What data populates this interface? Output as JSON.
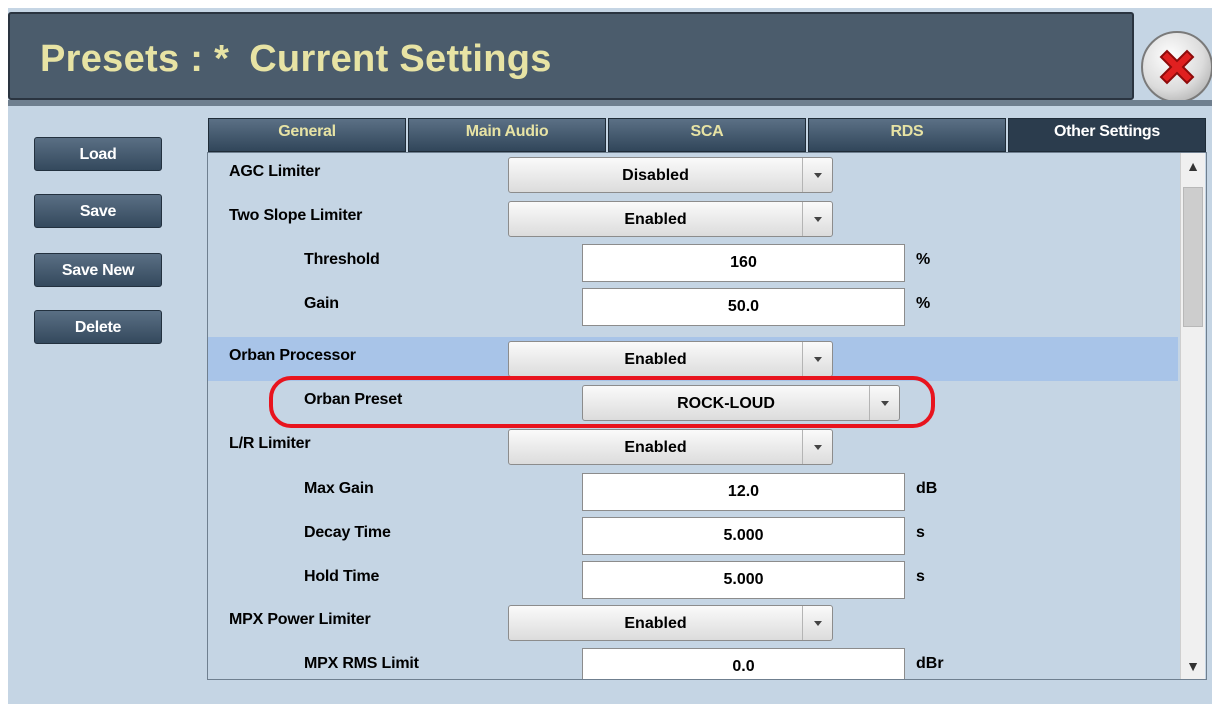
{
  "header": {
    "title_prefix": "Presets : *",
    "title_main": "Current Settings"
  },
  "sidebar": {
    "buttons": [
      "Load",
      "Save",
      "Save New",
      "Delete"
    ]
  },
  "tabs": [
    {
      "label": "General",
      "active": false
    },
    {
      "label": "Main Audio",
      "active": false
    },
    {
      "label": "SCA",
      "active": false
    },
    {
      "label": "RDS",
      "active": false
    },
    {
      "label": "Other Settings",
      "active": true
    }
  ],
  "settings": [
    {
      "label": "AGC Limiter",
      "value": "Disabled",
      "type": "dropdown"
    },
    {
      "label": "Two Slope Limiter",
      "value": "Enabled",
      "type": "dropdown"
    },
    {
      "label": "Threshold",
      "value": "160",
      "type": "input",
      "unit": "%"
    },
    {
      "label": "Gain",
      "value": "50.0",
      "type": "input",
      "unit": "%"
    },
    {
      "label": "Orban Processor",
      "value": "Enabled",
      "type": "dropdown",
      "selected": true
    },
    {
      "label": "Orban Preset",
      "value": "ROCK-LOUD",
      "type": "dropdown",
      "highlighted": true
    },
    {
      "label": "L/R Limiter",
      "value": "Enabled",
      "type": "dropdown"
    },
    {
      "label": "Max Gain",
      "value": "12.0",
      "type": "input",
      "unit": "dB"
    },
    {
      "label": "Decay Time",
      "value": "5.000",
      "type": "input",
      "unit": "s"
    },
    {
      "label": "Hold Time",
      "value": "5.000",
      "type": "input",
      "unit": "s"
    },
    {
      "label": "MPX Power Limiter",
      "value": "Enabled",
      "type": "dropdown"
    },
    {
      "label": "MPX RMS Limit",
      "value": "0.0",
      "type": "input",
      "unit": "dBr"
    }
  ],
  "scrollbar": {
    "up_glyph": "▲",
    "down_glyph": "▼"
  },
  "colors": {
    "title_text": "#e7e3a4",
    "selected_row": "#a8c4e8",
    "callout": "#e8141e",
    "background": "#c5d5e4"
  },
  "icons": {
    "close": "close-x-icon",
    "dropdown": "chevron-down-icon"
  }
}
